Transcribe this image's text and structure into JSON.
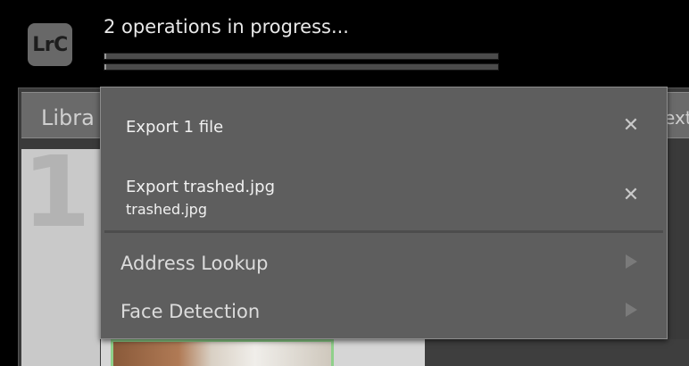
{
  "app": {
    "logo_text": "LrC"
  },
  "status": {
    "title": "2 operations in progress...",
    "progress": [
      0.005,
      0.005
    ]
  },
  "background": {
    "module_label": "Libra",
    "right_label": "ext",
    "big_number": "1"
  },
  "operations": [
    {
      "title": "Export 1 file",
      "subtitle": ""
    },
    {
      "title": "Export trashed.jpg",
      "subtitle": "trashed.jpg"
    }
  ],
  "menu_items": [
    {
      "label": "Address Lookup"
    },
    {
      "label": "Face Detection"
    }
  ],
  "icons": {
    "close": "close-icon",
    "submenu": "play-arrow-icon"
  },
  "colors": {
    "menu_bg": "#5e5e5e",
    "text": "#f1f1f1",
    "progress_track": "#4b4b4b"
  }
}
